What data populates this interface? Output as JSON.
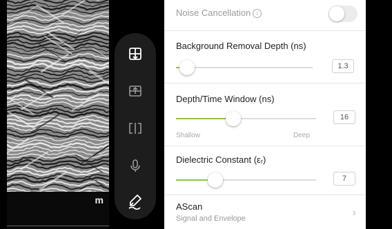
{
  "scan": {
    "unit_label": "m"
  },
  "toolbar": {
    "items": [
      {
        "icon": "display-settings-icon"
      },
      {
        "icon": "export-icon"
      },
      {
        "icon": "split-view-icon"
      },
      {
        "icon": "microphone-icon"
      },
      {
        "icon": "pen-edit-icon"
      }
    ]
  },
  "settings": {
    "noise": {
      "label": "Noise Cancellation",
      "enabled": false
    },
    "background": {
      "label": "Background Removal Depth (ns)",
      "value": "1.3",
      "fraction": 0.08
    },
    "depth": {
      "label": "Depth/Time Window (ns)",
      "value": "16",
      "fraction": 0.41,
      "min_label": "Shallow",
      "max_label": "Deep"
    },
    "dielectric": {
      "label": "Dielectric Constant (εᵣ)",
      "value": "7",
      "fraction": 0.28
    },
    "ascan": {
      "title": "AScan",
      "subtitle": "Signal and Envelope"
    }
  },
  "colors": {
    "accent": "#8cc63f",
    "toolbar": "#1d1d1d",
    "panel": "#ffffff"
  }
}
